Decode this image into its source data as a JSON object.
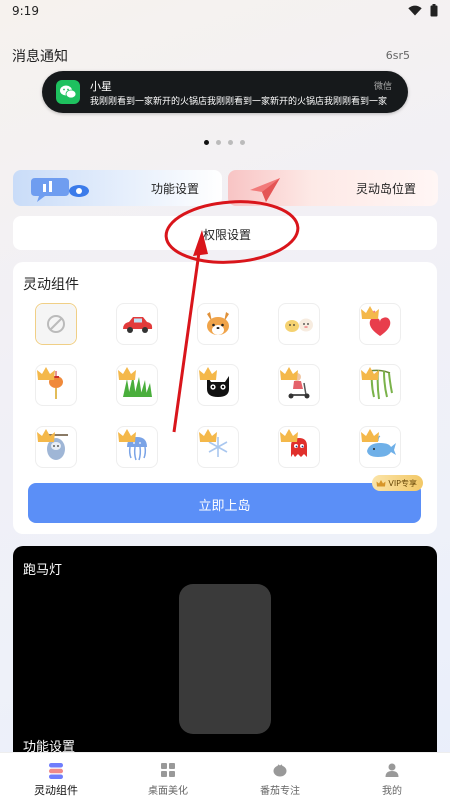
{
  "status_bar": {
    "time": "9:19"
  },
  "notification_section": {
    "title": "消息通知",
    "version": "6sr5",
    "preview": {
      "title": "小星",
      "app": "微信",
      "message": "我刚刚看到一家新开的火锅店我刚刚看到一家新开的火锅店我刚刚看到一家"
    },
    "pager": {
      "count": 4,
      "active": 0
    }
  },
  "buttons": {
    "function_settings": "功能设置",
    "island_position": "灵动岛位置",
    "permission_settings": "权限设置"
  },
  "widgets": {
    "title": "灵动组件",
    "items": [
      {
        "icon": "none-icon",
        "vip": false,
        "selected": true
      },
      {
        "icon": "car-icon",
        "vip": false
      },
      {
        "icon": "corgi-icon",
        "vip": false
      },
      {
        "icon": "chicks-icon",
        "vip": false
      },
      {
        "icon": "hearts-icon",
        "vip": true
      },
      {
        "icon": "lantern-icon",
        "vip": true
      },
      {
        "icon": "grass-icon",
        "vip": true
      },
      {
        "icon": "black-cat-icon",
        "vip": true
      },
      {
        "icon": "scooter-girl-icon",
        "vip": true
      },
      {
        "icon": "willow-icon",
        "vip": true
      },
      {
        "icon": "sloth-icon",
        "vip": true
      },
      {
        "icon": "jellyfish-icon",
        "vip": true
      },
      {
        "icon": "snowflake-icon",
        "vip": true
      },
      {
        "icon": "ghost-icon",
        "vip": true
      },
      {
        "icon": "whale-icon",
        "vip": true
      }
    ],
    "primary_button": "立即上岛",
    "vip_badge": "VIP专享"
  },
  "marquee": {
    "title": "跑马灯",
    "subtitle": "功能设置"
  },
  "tabbar": {
    "active": 0,
    "tabs": [
      {
        "label": "灵动组件",
        "icon": "dynamic-widgets-icon"
      },
      {
        "label": "桌面美化",
        "icon": "desktop-beautify-icon"
      },
      {
        "label": "番茄专注",
        "icon": "tomato-focus-icon"
      },
      {
        "label": "我的",
        "icon": "profile-icon"
      }
    ]
  },
  "colors": {
    "accent": "#5b8ff7",
    "annotation": "#d9151b",
    "vip_gold": "#f2c867"
  }
}
